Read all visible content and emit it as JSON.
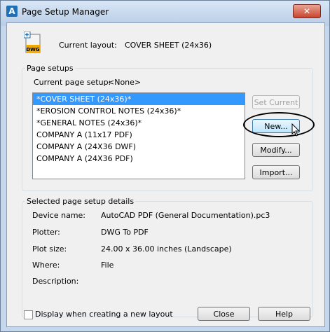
{
  "window": {
    "title": "Page Setup Manager",
    "close_glyph": "✕"
  },
  "icons": {
    "app": "autocad-a-icon",
    "dwg": "dwg-file-icon",
    "dwg_text": "DWG"
  },
  "current_layout": {
    "label": "Current layout:",
    "value": "COVER SHEET (24x36)"
  },
  "page_setups": {
    "legend": "Page setups",
    "current_label": "Current page setup:",
    "current_value": "<None>",
    "items": [
      "*COVER SHEET (24x36)*",
      "*EROSION CONTROL NOTES (24x36)*",
      "*GENERAL NOTES (24x36)*",
      "COMPANY A (11x17 PDF)",
      "COMPANY A (24X36 DWF)",
      "COMPANY A (24X36 PDF)"
    ],
    "selected_index": 0
  },
  "buttons": {
    "set_current": "Set Current",
    "new": "New...",
    "modify": "Modify...",
    "import": "Import...",
    "close": "Close",
    "help": "Help"
  },
  "details": {
    "legend": "Selected page setup details",
    "device_name_label": "Device name:",
    "device_name_value": "AutoCAD PDF (General Documentation).pc3",
    "plotter_label": "Plotter:",
    "plotter_value": "DWG To PDF",
    "plot_size_label": "Plot size:",
    "plot_size_value": "24.00 x 36.00 inches (Landscape)",
    "where_label": "Where:",
    "where_value": "File",
    "description_label": "Description:",
    "description_value": ""
  },
  "checkbox": {
    "label": "Display when creating a new layout",
    "checked": false
  },
  "colors": {
    "selection": "#3399ff",
    "close_button": "#c9452e",
    "frame": "#c5d7ec"
  }
}
